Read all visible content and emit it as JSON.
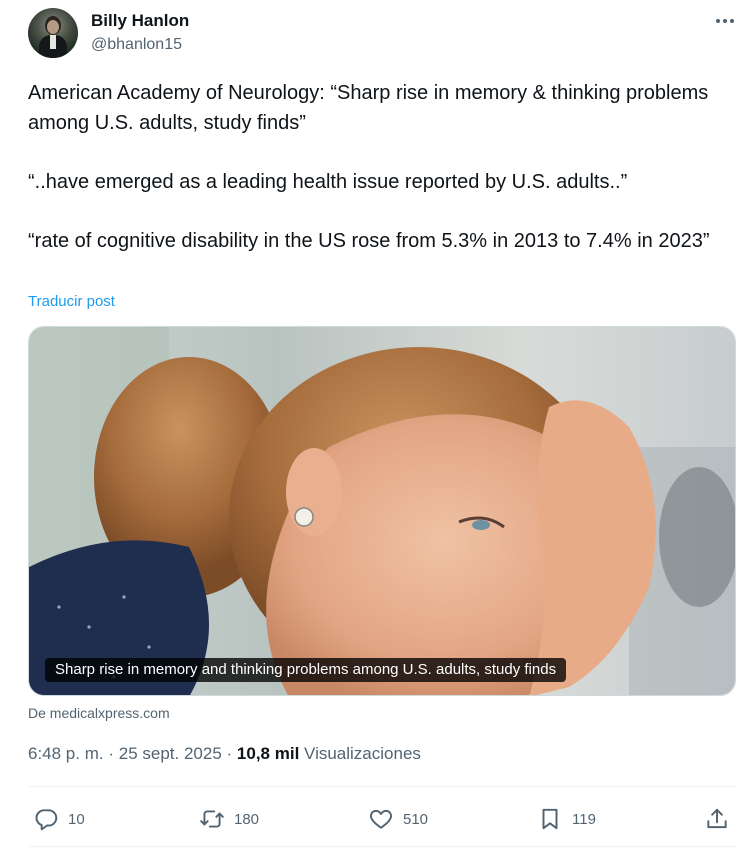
{
  "author": {
    "display_name": "Billy Hanlon",
    "handle": "@bhanlon15"
  },
  "post": {
    "paragraphs": [
      "American Academy of Neurology: “Sharp rise in memory & thinking problems among U.S. adults, study finds”",
      "“..have emerged as a leading health issue reported by U.S. adults..”",
      "“rate of cognitive disability in the US rose from 5.3% in 2013 to 7.4% in 2023”"
    ],
    "translate_label": "Traducir post"
  },
  "media": {
    "caption": "Sharp rise in memory and thinking problems among U.S. adults, study finds",
    "source": "De medicalxpress.com"
  },
  "meta": {
    "time": "6:48 p. m.",
    "separator": "·",
    "date": "25 sept. 2025",
    "views_count": "10,8 mil",
    "views_label": "Visualizaciones"
  },
  "actions": {
    "replies": "10",
    "reposts": "180",
    "likes": "510",
    "bookmarks": "119"
  },
  "icons": {
    "more": "more-horizontal-icon",
    "reply": "reply-bubble-icon",
    "repost": "repost-arrows-icon",
    "like": "heart-icon",
    "bookmark": "bookmark-icon",
    "share": "share-upload-icon"
  },
  "colors": {
    "link": "#1d9bf0",
    "secondary_text": "#536471",
    "primary_text": "#0f1419"
  }
}
